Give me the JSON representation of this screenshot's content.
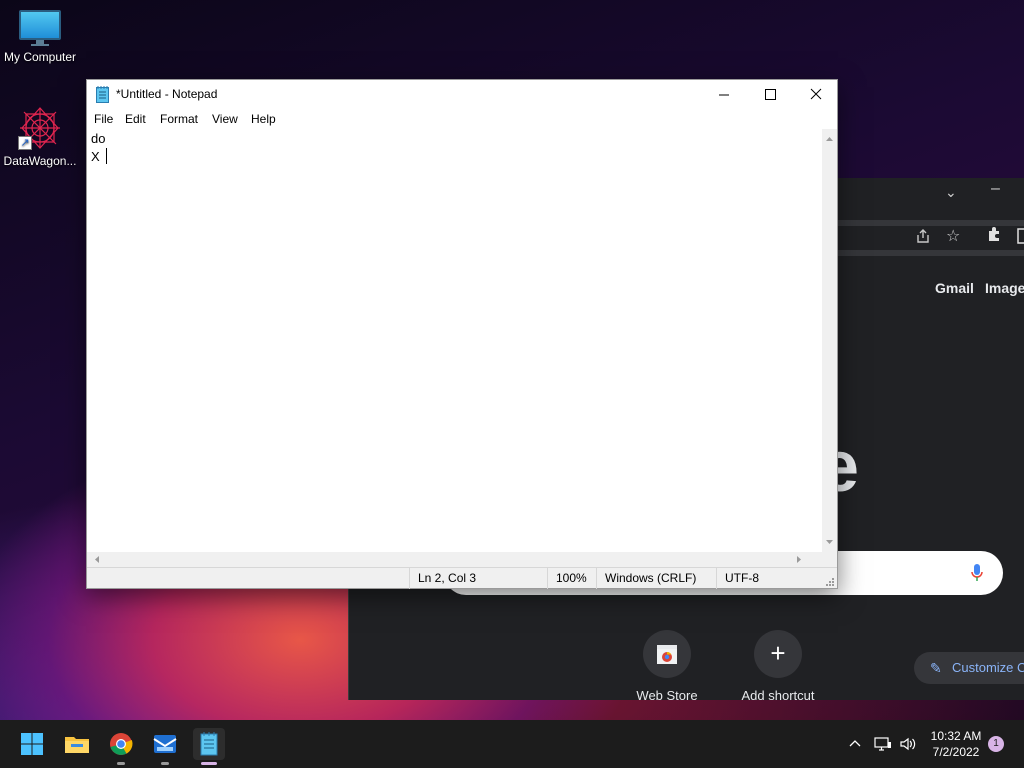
{
  "desktop": {
    "icons": [
      {
        "label": "My Computer",
        "icon": "monitor-icon"
      },
      {
        "label": "DataWagon...",
        "icon": "datawagon-logo-icon"
      }
    ]
  },
  "notepad": {
    "title": "*Untitled - Notepad",
    "menu": [
      "File",
      "Edit",
      "Format",
      "View",
      "Help"
    ],
    "content_lines": [
      "do",
      "X "
    ],
    "status": {
      "position": "Ln 2, Col 3",
      "zoom": "100%",
      "line_ending": "Windows (CRLF)",
      "encoding": "UTF-8"
    }
  },
  "chrome": {
    "links": {
      "gmail": "Gmail",
      "images": "Images"
    },
    "logo_fragment": "e",
    "shortcuts": [
      {
        "label": "Web Store",
        "icon": "web-store-icon"
      },
      {
        "label": "Add shortcut",
        "icon": "plus-icon"
      }
    ],
    "customize_label": "Customize C"
  },
  "taskbar": {
    "apps": [
      "start-icon",
      "file-explorer-icon",
      "chrome-icon",
      "mail-app-icon",
      "notepad-icon"
    ],
    "clock": {
      "time": "10:32 AM",
      "date": "7/2/2022"
    },
    "notification_count": "1"
  },
  "colors": {
    "accent": "#d8b4e6",
    "taskbar": "#1c1c1c",
    "chrome_bg": "#202124"
  }
}
